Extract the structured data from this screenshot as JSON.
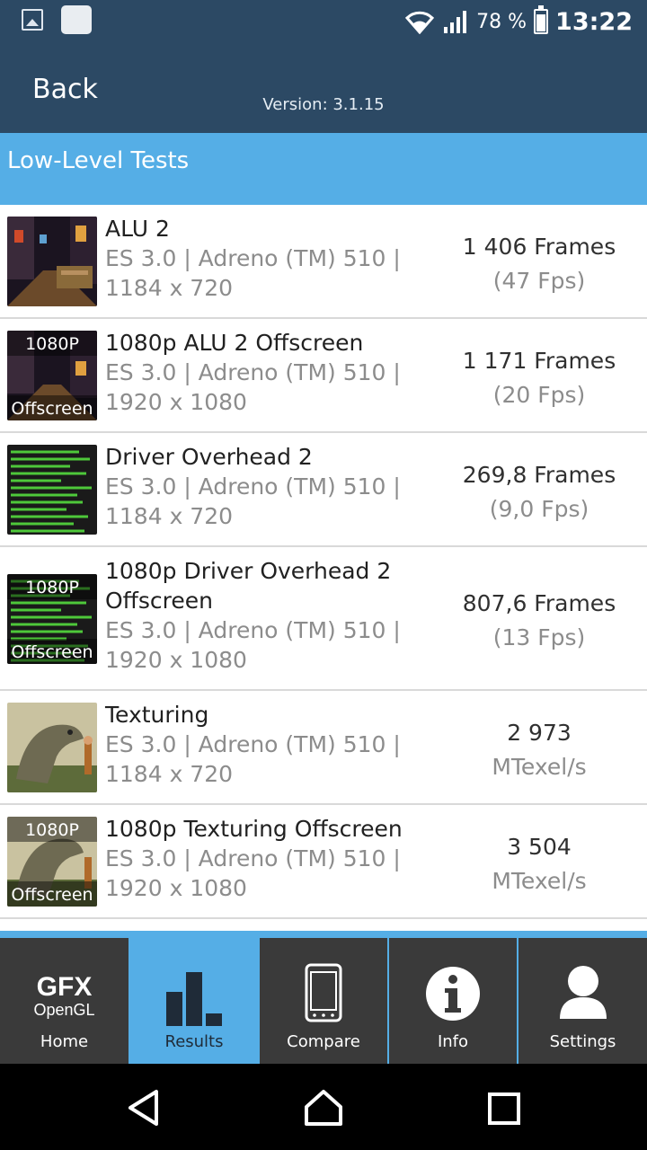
{
  "status_bar": {
    "battery": "78 %",
    "time": "13:22"
  },
  "header": {
    "back_label": "Back",
    "version": "Version: 3.1.15"
  },
  "section": {
    "title": "Low-Level Tests"
  },
  "tests": [
    {
      "name": "ALU 2",
      "detail1": "ES 3.0 | Adreno (TM) 510 |",
      "detail2": "1184 x 720",
      "score": "1 406 Frames",
      "sub": "(47 Fps)",
      "badge_top": "",
      "badge_bottom": ""
    },
    {
      "name": "1080p ALU 2 Offscreen",
      "detail1": "ES 3.0 | Adreno (TM) 510 |",
      "detail2": "1920 x 1080",
      "score": "1 171 Frames",
      "sub": "(20 Fps)",
      "badge_top": "1080P",
      "badge_bottom": "Offscreen"
    },
    {
      "name": "Driver Overhead 2",
      "detail1": "ES 3.0 | Adreno (TM) 510 |",
      "detail2": "1184 x 720",
      "score": "269,8 Frames",
      "sub": "(9,0 Fps)",
      "badge_top": "",
      "badge_bottom": ""
    },
    {
      "name": "1080p Driver Overhead 2",
      "name2": "Offscreen",
      "detail1": "ES 3.0 | Adreno (TM) 510 |",
      "detail2": "1920 x 1080",
      "score": "807,6 Frames",
      "sub": "(13 Fps)",
      "badge_top": "1080P",
      "badge_bottom": "Offscreen"
    },
    {
      "name": "Texturing",
      "detail1": "ES 3.0 | Adreno (TM) 510 |",
      "detail2": "1184 x 720",
      "score": "2 973",
      "sub": "MTexel/s",
      "badge_top": "",
      "badge_bottom": ""
    },
    {
      "name": "1080p Texturing Offscreen",
      "detail1": "ES 3.0 | Adreno (TM) 510 |",
      "detail2": "1920 x 1080",
      "score": "3 504",
      "sub": "MTexel/s",
      "badge_top": "1080P",
      "badge_bottom": "Offscreen"
    }
  ],
  "tabs": {
    "home": {
      "logo_top": "GFX",
      "logo_bottom": "OpenGL",
      "label": "Home"
    },
    "results": {
      "label": "Results"
    },
    "compare": {
      "label": "Compare"
    },
    "info": {
      "label": "Info"
    },
    "settings": {
      "label": "Settings"
    }
  },
  "colors": {
    "header": "#2c4964",
    "accent": "#55aee6",
    "tab_bg": "#3a3a3a"
  }
}
